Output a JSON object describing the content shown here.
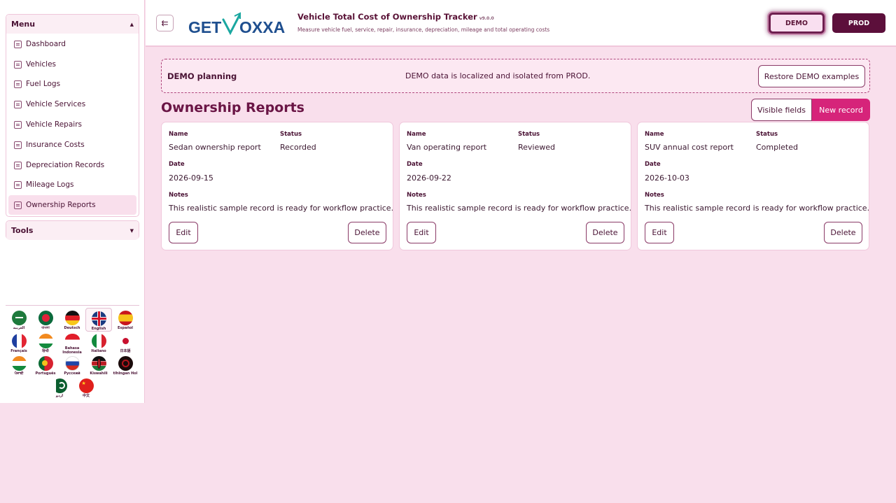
{
  "sidebar": {
    "menu_title": "Menu",
    "tools_title": "Tools",
    "items": [
      {
        "label": "Dashboard"
      },
      {
        "label": "Vehicles"
      },
      {
        "label": "Fuel Logs"
      },
      {
        "label": "Vehicle Services"
      },
      {
        "label": "Vehicle Repairs"
      },
      {
        "label": "Insurance Costs"
      },
      {
        "label": "Depreciation Records"
      },
      {
        "label": "Mileage Logs"
      },
      {
        "label": "Ownership Reports"
      }
    ],
    "active_item": "Ownership Reports"
  },
  "languages": [
    {
      "label": "العربية",
      "icon": "flag-saudi-arabia-icon"
    },
    {
      "label": "বাংলা",
      "icon": "flag-bangladesh-icon"
    },
    {
      "label": "Deutsch",
      "icon": "flag-germany-icon"
    },
    {
      "label": "English",
      "icon": "flag-uk-icon",
      "selected": true
    },
    {
      "label": "Español",
      "icon": "flag-spain-icon"
    },
    {
      "label": "Français",
      "icon": "flag-france-icon"
    },
    {
      "label": "हिन्दी",
      "icon": "flag-india-icon"
    },
    {
      "label": "Bahasa Indonesia",
      "icon": "flag-indonesia-icon"
    },
    {
      "label": "Italiano",
      "icon": "flag-italy-icon"
    },
    {
      "label": "日本語",
      "icon": "flag-japan-icon"
    },
    {
      "label": "ਪੰਜਾਬੀ",
      "icon": "flag-india-punjabi-icon"
    },
    {
      "label": "Português",
      "icon": "flag-portugal-icon"
    },
    {
      "label": "Русский",
      "icon": "flag-russia-icon"
    },
    {
      "label": "Kiswahili",
      "icon": "flag-kenya-icon"
    },
    {
      "label": "tlhIngan Hol",
      "icon": "flag-klingon-icon"
    },
    {
      "label": "اردو",
      "icon": "flag-pakistan-icon"
    },
    {
      "label": "中文",
      "icon": "flag-china-icon"
    }
  ],
  "header": {
    "logo_text_left": "GET",
    "logo_text_right": "OXXA",
    "title": "Vehicle Total Cost of Ownership Tracker",
    "version": "v9.0.0",
    "subtitle": "Measure vehicle fuel, service, repair, insurance, depreciation, mileage and total operating costs",
    "toggle_icon": "collapse-sidebar-icon",
    "demo_label": "DEMO",
    "prod_label": "PROD"
  },
  "banner": {
    "title": "DEMO planning",
    "message": "DEMO data is localized and isolated from PROD.",
    "restore_label": "Restore DEMO examples"
  },
  "page": {
    "title": "Ownership Reports",
    "visible_fields_label": "Visible fields",
    "new_record_label": "New record"
  },
  "field_labels": {
    "name": "Name",
    "status": "Status",
    "date": "Date",
    "notes": "Notes"
  },
  "records": [
    {
      "name": "Sedan ownership report",
      "status": "Recorded",
      "date": "2026-09-15",
      "notes": "This realistic sample record is ready for workflow practice.",
      "edit_label": "Edit",
      "delete_label": "Delete"
    },
    {
      "name": "Van operating report",
      "status": "Reviewed",
      "date": "2026-09-22",
      "notes": "This realistic sample record is ready for workflow practice.",
      "edit_label": "Edit",
      "delete_label": "Delete"
    },
    {
      "name": "SUV annual cost report",
      "status": "Completed",
      "date": "2026-10-03",
      "notes": "This realistic sample record is ready for workflow practice.",
      "edit_label": "Edit",
      "delete_label": "Delete"
    }
  ],
  "colors": {
    "background": "#f9dfec",
    "accent": "#d6247a",
    "brand_dark": "#5c0f3b",
    "logo_blue": "#1f4f8f",
    "logo_teal": "#1aa7a0"
  }
}
